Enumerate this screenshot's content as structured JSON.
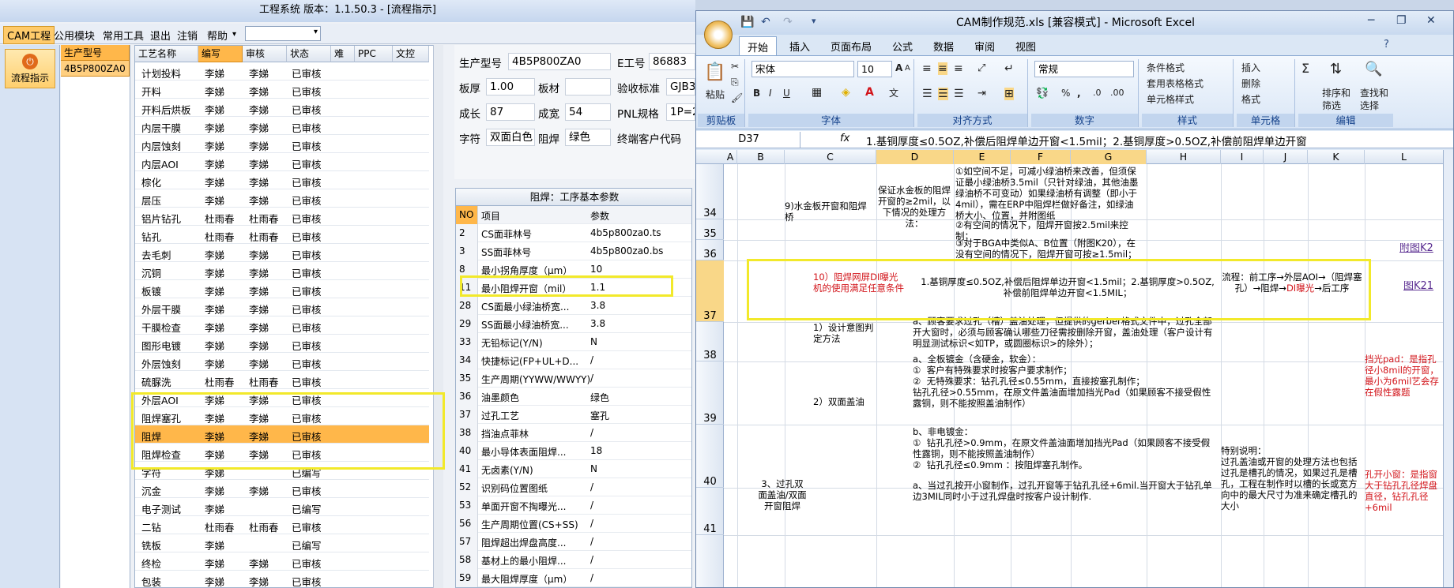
{
  "left_app": {
    "title": "工程系统  版本：1.1.50.3 - [流程指示]",
    "menu": [
      "CAM工程",
      "公用模块",
      "常用工具",
      "退出",
      "注销",
      "帮助"
    ],
    "menu_dropdown": "▾",
    "sidebar_button": "流程指示",
    "product_header": "生产型号",
    "product_value": "4B5P800ZA0",
    "process_headers": [
      "工艺名称",
      "编写",
      "审核",
      "状态",
      "难",
      "PPC",
      "文控"
    ],
    "process_rows": [
      [
        "计划投料",
        "李娣",
        "李娣",
        "已审核"
      ],
      [
        "开料",
        "李娣",
        "李娣",
        "已审核"
      ],
      [
        "开料后烘板",
        "李娣",
        "李娣",
        "已审核"
      ],
      [
        "内层干膜",
        "李娣",
        "李娣",
        "已审核"
      ],
      [
        "内层蚀刻",
        "李娣",
        "李娣",
        "已审核"
      ],
      [
        "内层AOI",
        "李娣",
        "李娣",
        "已审核"
      ],
      [
        "棕化",
        "李娣",
        "李娣",
        "已审核"
      ],
      [
        "层压",
        "李娣",
        "李娣",
        "已审核"
      ],
      [
        "铝片钻孔",
        "杜雨春",
        "杜雨春",
        "已审核"
      ],
      [
        "钻孔",
        "杜雨春",
        "杜雨春",
        "已审核"
      ],
      [
        "去毛刺",
        "李娣",
        "李娣",
        "已审核"
      ],
      [
        "沉铜",
        "李娣",
        "李娣",
        "已审核"
      ],
      [
        "板镀",
        "李娣",
        "李娣",
        "已审核"
      ],
      [
        "外层干膜",
        "李娣",
        "李娣",
        "已审核"
      ],
      [
        "干膜检查",
        "李娣",
        "李娣",
        "已审核"
      ],
      [
        "图形电镀",
        "李娣",
        "李娣",
        "已审核"
      ],
      [
        "外层蚀刻",
        "李娣",
        "李娣",
        "已审核"
      ],
      [
        "硫脲洗",
        "杜雨春",
        "杜雨春",
        "已审核"
      ],
      [
        "外层AOI",
        "李娣",
        "李娣",
        "已审核"
      ],
      [
        "阻焊塞孔",
        "李娣",
        "李娣",
        "已审核"
      ],
      [
        "阻焊",
        "李娣",
        "李娣",
        "已审核"
      ],
      [
        "阻焊检查",
        "李娣",
        "李娣",
        "已审核"
      ],
      [
        "字符",
        "李娣",
        "",
        "已编写"
      ],
      [
        "沉金",
        "李娣",
        "李娣",
        "已审核"
      ],
      [
        "电子测试",
        "李娣",
        "",
        "已编写"
      ],
      [
        "二钻",
        "杜雨春",
        "杜雨春",
        "已审核"
      ],
      [
        "铣板",
        "李娣",
        "",
        "已编写"
      ],
      [
        "终检",
        "李娣",
        "李娣",
        "已审核"
      ],
      [
        "包装",
        "李娣",
        "李娣",
        "已审核"
      ]
    ],
    "info": {
      "prod_label": "生产型号",
      "prod_value": "4B5P800ZA0",
      "e_label": "E工号",
      "e_value": "86883",
      "thick_label": "板厚",
      "thick_value": "1.00",
      "mat_label": "板材",
      "mat_value": "",
      "std_label": "验收标准",
      "std_value": "GJB3",
      "len_label": "成长",
      "len_value": "87",
      "wid_label": "成宽",
      "wid_value": "54",
      "pnl_label": "PNL规格",
      "pnl_value": "1P=2",
      "char_label": "字符",
      "char_value": "双面白色",
      "sm_label": "阻焊",
      "sm_value": "绿色",
      "cust_label": "终端客户代码",
      "cust_value": ""
    },
    "param_title": "阻焊：工序基本参数",
    "param_headers": [
      "NO",
      "项目",
      "参数"
    ],
    "param_rows": [
      [
        "2",
        "CS面菲林号",
        "4b5p800za0.ts"
      ],
      [
        "3",
        "SS面菲林号",
        "4b5p800za0.bs"
      ],
      [
        "8",
        "最小拐角厚度（μm）",
        "10"
      ],
      [
        "11",
        "最小阻焊开窗（mil）",
        "1.1"
      ],
      [
        "28",
        "CS面最小绿油桥宽...",
        "3.8"
      ],
      [
        "29",
        "SS面最小绿油桥宽...",
        "3.8"
      ],
      [
        "33",
        "无铅标记(Y/N)",
        "N"
      ],
      [
        "34",
        "快捷标记(FP+UL+D...",
        "/"
      ],
      [
        "35",
        "生产周期(YYWW/WWYY)",
        "/"
      ],
      [
        "36",
        "油墨颜色",
        "绿色"
      ],
      [
        "37",
        "过孔工艺",
        "塞孔"
      ],
      [
        "38",
        "挡油点菲林",
        "/"
      ],
      [
        "40",
        "最小导体表面阻焊...",
        "18"
      ],
      [
        "41",
        "无卤素(Y/N)",
        "N"
      ],
      [
        "52",
        "识别码位置图纸",
        "/"
      ],
      [
        "53",
        "单面开窗不掏曝光...",
        "/"
      ],
      [
        "56",
        "生产周期位置(CS+SS)",
        "/"
      ],
      [
        "57",
        "阻焊超出焊盘高度...",
        "/"
      ],
      [
        "58",
        "基材上的最小阻焊...",
        "/"
      ],
      [
        "59",
        "最大阻焊厚度（μm）",
        "/"
      ]
    ]
  },
  "excel": {
    "title": "CAM制作规范.xls [兼容模式] - Microsoft Excel",
    "tabs": [
      "开始",
      "插入",
      "页面布局",
      "公式",
      "数据",
      "审阅",
      "视图"
    ],
    "ribbon": {
      "paste": "粘贴",
      "clipboard": "剪贴板",
      "font_name": "宋体",
      "font_size": "10",
      "font_group": "字体",
      "align_group": "对齐方式",
      "num_format": "常规",
      "number_group": "数字",
      "cond_format": "条件格式",
      "table_format": "套用表格格式",
      "cell_style": "单元格样式",
      "style_group": "样式",
      "insert": "插入",
      "delete": "删除",
      "format": "格式",
      "cells_group": "单元格",
      "sort": "排序和",
      "filter": "筛选",
      "find": "查找和",
      "select": "选择",
      "edit_group": "编辑"
    },
    "name_box": "D37",
    "fx": "fx",
    "formula": "1.基铜厚度≤0.5OZ,补偿后阻焊单边开窗<1.5mil；2.基铜厚度>0.5OZ,补偿前阻焊单边开窗",
    "columns": [
      "A",
      "B",
      "C",
      "D",
      "E",
      "F",
      "G",
      "H",
      "I",
      "J",
      "K",
      "L"
    ],
    "rows": [
      "34",
      "35",
      "36",
      "37",
      "38",
      "39",
      "40",
      "41"
    ],
    "cells": {
      "c34": "9)水金板开窗和阻焊桥",
      "d34": "保证水金板的阻焊开窗的≥2mil，以下情况的处理方法：",
      "e34": "①如空间不足，可减小绿油桥来改善，但须保证最小绿油桥3.5mil（只针对绿油，其他油墨绿油桥不可变动）如果绿油桥有调整（即小于4mil），需在ERP中阻焊栏做好备注，如绿油桥大小、位置，并附图纸",
      "e35": "②有空间的情况下，阻焊开窗按2.5mil来控制；",
      "e36": "③对于BGA中类似A、B位置（附图K20），在没有空间的情况下，阻焊开窗可按≥1.5mil；",
      "l36": "附图K2",
      "c37": "10）阻焊网屏DI曝光机的使用满足任意条件",
      "d37": "1.基铜厚度≤0.5OZ,补偿后阻焊单边开窗<1.5mil；2.基铜厚度>0.5OZ,补偿前阻焊单边开窗<1.5MIL；",
      "i37_a": "流程：前工序→外层AOI→（阻焊塞孔）→阻焊→",
      "i37_red": "DI曝光",
      "i37_b": "→后工序",
      "l37": "图K21",
      "c38": "1）设计意图判定方法",
      "e38": "a、顾客要求过孔（槽）盖油处理，但提供的gerber格式文件中，过孔全部开大窗时，必须与顾客确认哪些刀径需按删除开窗，盖油处理（客户设计有明显测试标识<如TP，或圆圈标识>的除外）；",
      "c39": "2）双面盖油",
      "e39": "a、全板镀金（含硬金，软金）：\n①  客户有特殊要求时按客户要求制作；\n②  无特殊要求：钻孔孔径≤0.55mm，直接按塞孔制作；\n钻孔孔径>0.55mm，在原文件盖油面增加挡光Pad（如果顾客不接受假性露铜，则不能按照盖油制作）",
      "l39": "挡光pad：是指孔径小8mil的开窗，最小为6mil艺会存在假性露题",
      "e40": "b、非电镀金：\n①  钻孔孔径>0.9mm，在原文件盖油面增加挡光Pad（如果顾客不接受假性露铜，则不能按照盖油制作）\n②  钻孔孔径≤0.9mm ：按阻焊塞孔制作。",
      "i40": "特别说明：\n过孔盖油或开窗的处理方法也包括过孔是槽孔的情况，如果过孔是槽孔，工程在制作时以槽的长或宽方向中的最大尺寸为准来确定槽孔的大小",
      "l40": "孔开小窗：是指窗大于钻孔孔径焊盘直径，钻孔孔径+6mil",
      "b41": "3、过孔双面盖油/双面开窗阻焊",
      "e41": "a、当过孔按开小窗制作，过孔开窗等于钻孔孔径+6mil.当开窗大于钻孔单边3MIL同时小于过孔焊盘时按客户设计制作."
    },
    "colors": {
      "red": "#d2141a",
      "link": "#5a2d91",
      "highlight": "#f2e92a",
      "orange": "#ffb74a"
    }
  }
}
